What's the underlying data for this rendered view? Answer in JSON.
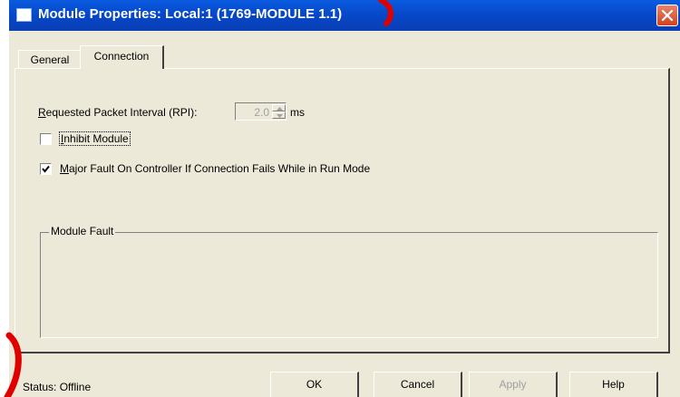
{
  "window": {
    "title": "Module Properties: Local:1 (1769-MODULE 1.1)",
    "icon": "window-icon",
    "close_icon": "close-icon"
  },
  "tabs": [
    {
      "label": "General",
      "selected": false
    },
    {
      "label": "Connection",
      "selected": true
    }
  ],
  "connection": {
    "rpi_label_prefix": "R",
    "rpi_label_rest": "equested Packet Interval (RPI):",
    "rpi_value": "2.0",
    "rpi_unit": "ms",
    "inhibit_label_prefix": "I",
    "inhibit_label_rest": "nhibit Module",
    "inhibit_checked": false,
    "major_fault_label_prefix": "M",
    "major_fault_label_rest": "ajor Fault On Controller If Connection Fails While in Run Mode",
    "major_fault_checked": true,
    "module_fault_title": "Module Fault"
  },
  "footer": {
    "status": "Status:  Offline",
    "buttons": {
      "ok": "OK",
      "cancel": "Cancel",
      "apply": "Apply",
      "help": "Help"
    }
  },
  "colors": {
    "title_bar": "#0a5be0",
    "dialog_bg": "#ece9d8",
    "annotation": "#e00000"
  }
}
